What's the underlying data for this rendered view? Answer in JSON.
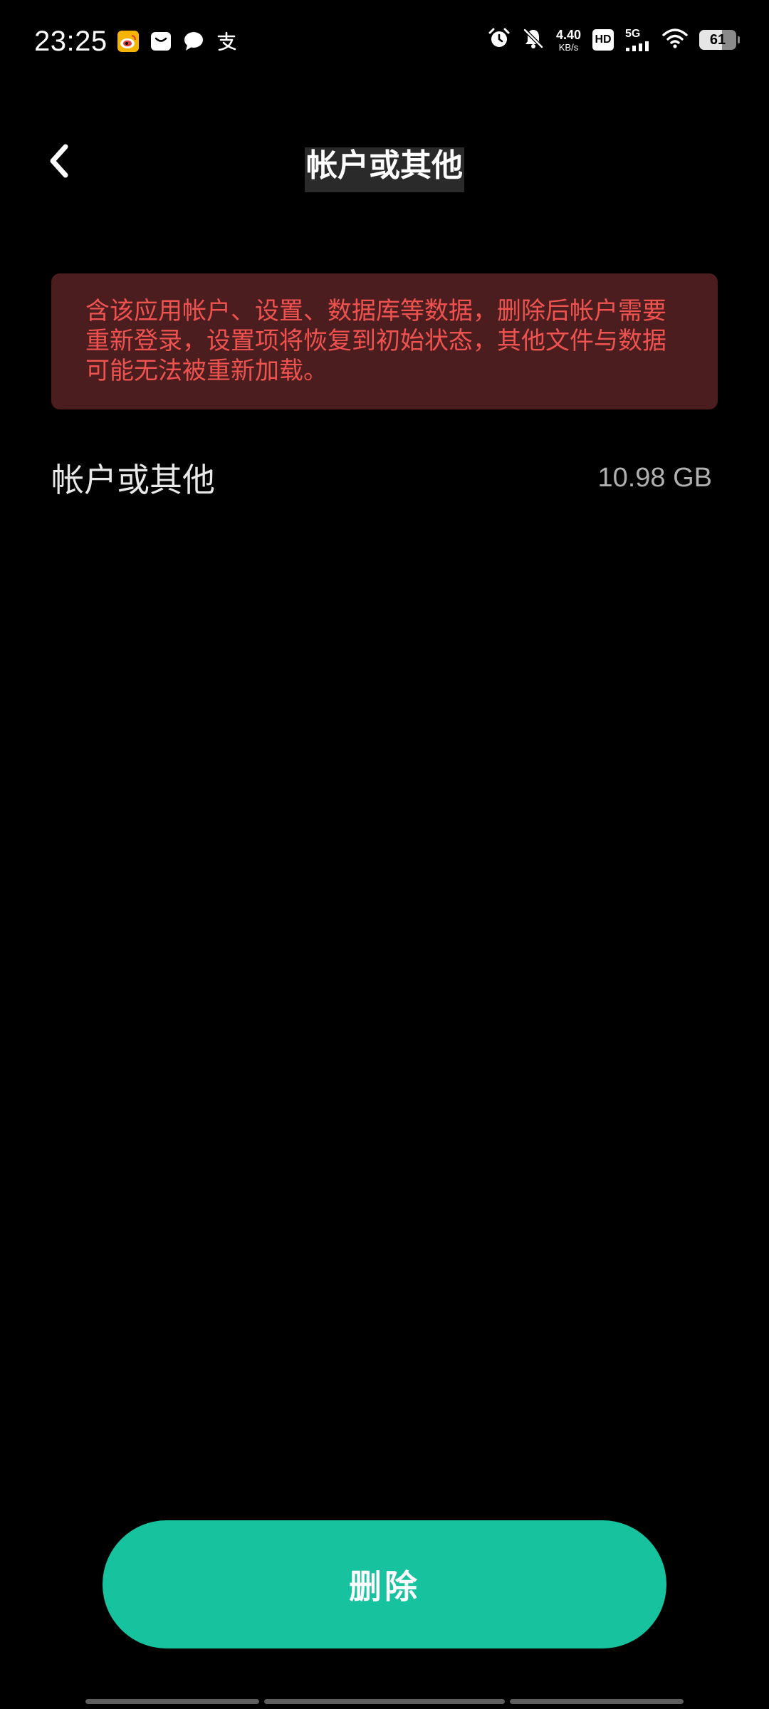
{
  "status_bar": {
    "time": "23:25",
    "notification_icons": [
      "weibo-icon",
      "message-icon",
      "chat-bubble-icon",
      "alipay-icon"
    ],
    "net_speed_value": "4.40",
    "net_speed_unit": "KB/s",
    "hd_label": "HD",
    "network_type": "5G",
    "battery_level": "61",
    "battery_fraction": 0.61
  },
  "header": {
    "title": "帐户或其他",
    "back_icon": "chevron-left-icon"
  },
  "warning": {
    "text": "含该应用帐户、设置、数据库等数据，删除后帐户需要重新登录，设置项将恢复到初始状态，其他文件与数据可能无法被重新加载。",
    "color": "#ef5350",
    "background": "#4c1d1f"
  },
  "storage": {
    "label": "帐户或其他",
    "size": "10.98 GB"
  },
  "actions": {
    "delete_label": "删除",
    "accent_color": "#17c29e"
  }
}
